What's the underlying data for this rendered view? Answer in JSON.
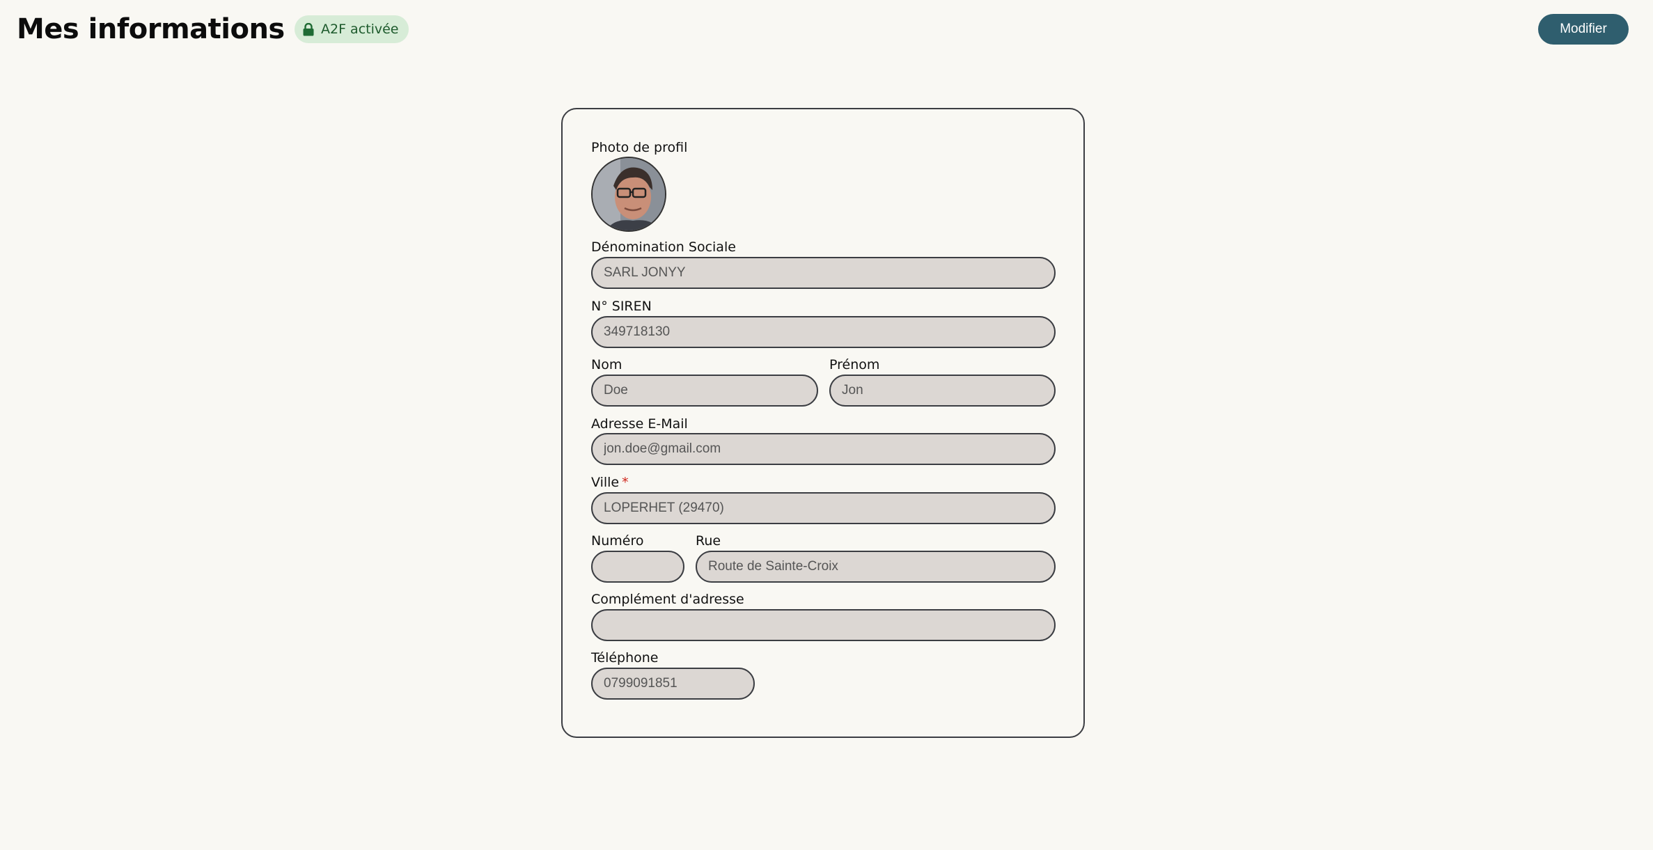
{
  "header": {
    "title": "Mes informations",
    "badge_label": "A2F activée",
    "badge_icon": "lock-icon",
    "modify_label": "Modifier"
  },
  "colors": {
    "background": "#f9f8f3",
    "badge_bg": "#d7ecd7",
    "badge_text": "#1d5a2c",
    "button_bg": "#2f5e6e",
    "field_bg": "#dcd7d3",
    "required": "#d0261c"
  },
  "form": {
    "photo_label": "Photo de profil",
    "company_name": {
      "label": "Dénomination Sociale",
      "value": "SARL JONYY"
    },
    "siren": {
      "label": "N° SIREN",
      "value": "349718130"
    },
    "last_name": {
      "label": "Nom",
      "value": "Doe"
    },
    "first_name": {
      "label": "Prénom",
      "value": "Jon"
    },
    "email": {
      "label": "Adresse E-Mail",
      "value": "jon.doe@gmail.com"
    },
    "city": {
      "label": "Ville",
      "required_mark": "*",
      "value": "LOPERHET (29470)"
    },
    "street_number": {
      "label": "Numéro",
      "value": ""
    },
    "street": {
      "label": "Rue",
      "value": "Route de Sainte-Croix"
    },
    "address_complement": {
      "label": "Complément d'adresse",
      "value": ""
    },
    "phone": {
      "label": "Téléphone",
      "value": "0799091851"
    }
  }
}
